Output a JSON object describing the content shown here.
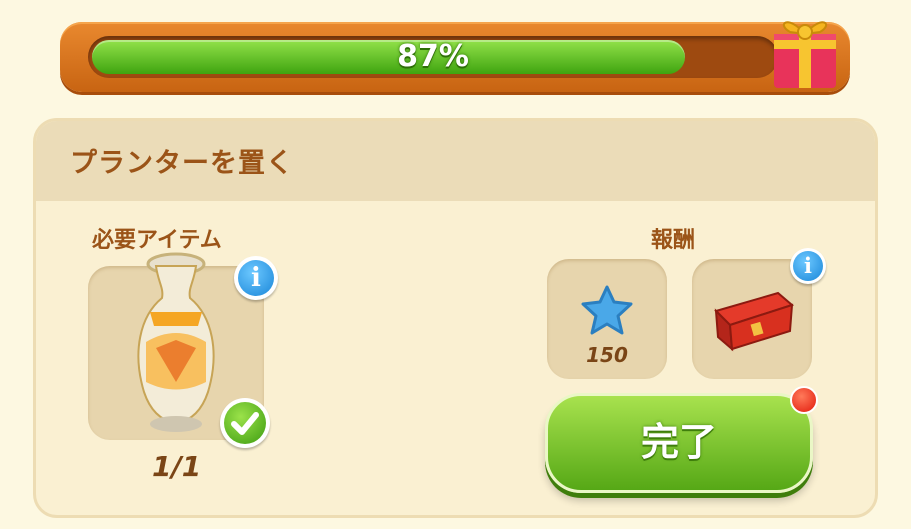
{
  "progress": {
    "label": "87%",
    "value": 0.87
  },
  "card": {
    "title": "プランターを置く",
    "required": {
      "label": "必要アイテム",
      "item_icon": "vase-icon",
      "count": "1/1"
    },
    "rewards": {
      "label": "報酬",
      "items": [
        {
          "icon": "star-icon",
          "amount": "150"
        },
        {
          "icon": "treasure-chest-icon"
        }
      ]
    },
    "done_button": {
      "label": "完了"
    }
  },
  "colors": {
    "accent_orange": "#d9761f",
    "progress_green": "#5bc21c",
    "title_brown": "#9b5418",
    "button_green": "#7bc631",
    "notify_red": "#e21a0c"
  }
}
